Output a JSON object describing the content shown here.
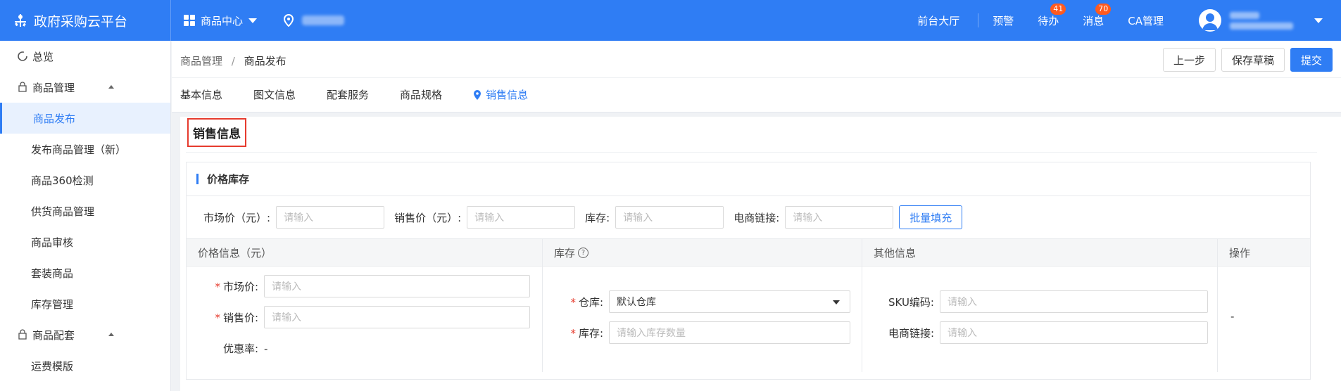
{
  "topbar": {
    "brand": "政府采购云平台",
    "menu_label": "商品中心",
    "links": {
      "hall": "前台大厅",
      "warning": "预警",
      "todo": "待办",
      "message": "消息",
      "ca": "CA管理"
    },
    "badges": {
      "todo": "41",
      "message": "70"
    },
    "colors": {
      "primary": "#2f7df4",
      "badge": "#ff5a1f"
    }
  },
  "sidebar": {
    "overview": "总览",
    "group1": "商品管理",
    "group1_items": [
      "商品发布",
      "发布商品管理（新）",
      "商品360检测",
      "供货商品管理",
      "商品审核",
      "套装商品",
      "库存管理"
    ],
    "group2": "商品配套",
    "group2_items": [
      "运费模版"
    ]
  },
  "header": {
    "breadcrumb": [
      "商品管理",
      "商品发布"
    ],
    "breadcrumb_sep": "/",
    "buttons": {
      "prev": "上一步",
      "draft": "保存草稿",
      "submit": "提交"
    },
    "tabs": [
      "基本信息",
      "图文信息",
      "配套服务",
      "商品规格",
      "销售信息"
    ]
  },
  "section": {
    "title": "销售信息",
    "card_title": "价格库存",
    "batch": {
      "market_price": "市场价（元）:",
      "sale_price": "销售价（元）:",
      "stock": "库存:",
      "ecom_link": "电商链接:",
      "placeholder": "请输入",
      "fill_button": "批量填充"
    },
    "table": {
      "headers": [
        "价格信息（元）",
        "库存",
        "其他信息",
        "操作"
      ],
      "price": {
        "market_label": "市场价:",
        "sale_label": "销售价:",
        "discount_label": "优惠率:",
        "discount_value": "-",
        "placeholder": "请输入"
      },
      "stock": {
        "warehouse_label": "仓库:",
        "warehouse_value": "默认仓库",
        "stock_label": "库存:",
        "stock_placeholder": "请输入库存数量"
      },
      "other": {
        "sku_label": "SKU编码:",
        "link_label": "电商链接:",
        "placeholder": "请输入"
      },
      "action": "-"
    }
  }
}
